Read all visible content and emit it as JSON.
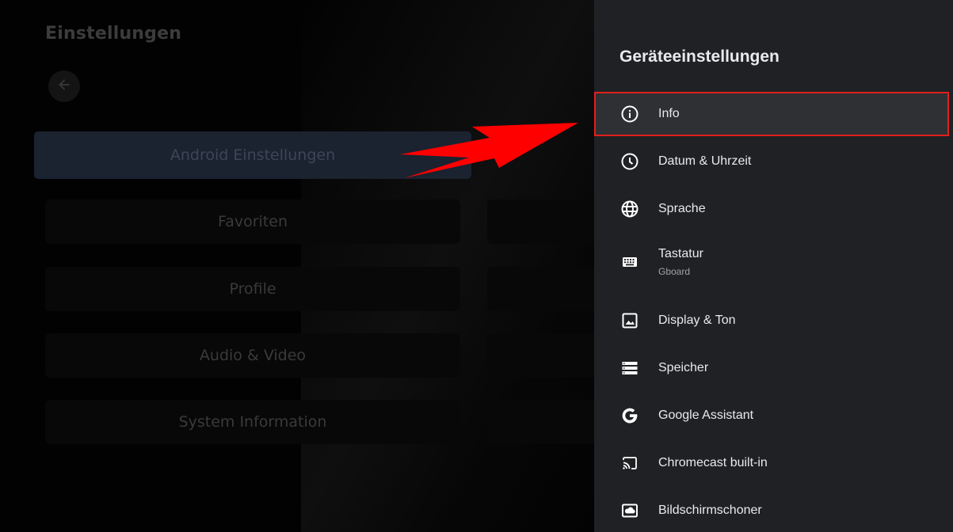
{
  "left_screen": {
    "title": "Einstellungen",
    "back_icon": "arrow-left-icon",
    "tiles": [
      {
        "label": "Android Einstellungen",
        "focused": true
      },
      {
        "label": "Favoriten"
      },
      {
        "label": "Profile"
      },
      {
        "label": "Audio & Video"
      },
      {
        "label": "System Information"
      }
    ]
  },
  "panel": {
    "title": "Geräteeinstellungen",
    "items": [
      {
        "label": "Info",
        "icon": "info-icon",
        "selected": true
      },
      {
        "label": "Datum & Uhrzeit",
        "icon": "clock-icon"
      },
      {
        "label": "Sprache",
        "icon": "globe-icon"
      },
      {
        "label": "Tastatur",
        "sub": "Gboard",
        "icon": "keyboard-icon"
      },
      {
        "label": "Display & Ton",
        "icon": "image-icon"
      },
      {
        "label": "Speicher",
        "icon": "storage-icon"
      },
      {
        "label": "Google Assistant",
        "icon": "google-icon"
      },
      {
        "label": "Chromecast built-in",
        "icon": "cast-icon"
      },
      {
        "label": "Bildschirmschoner",
        "icon": "screensaver-icon"
      }
    ]
  },
  "colors": {
    "highlight_border": "#e0201e",
    "arrow": "#ff0000",
    "panel_bg": "#202124"
  }
}
